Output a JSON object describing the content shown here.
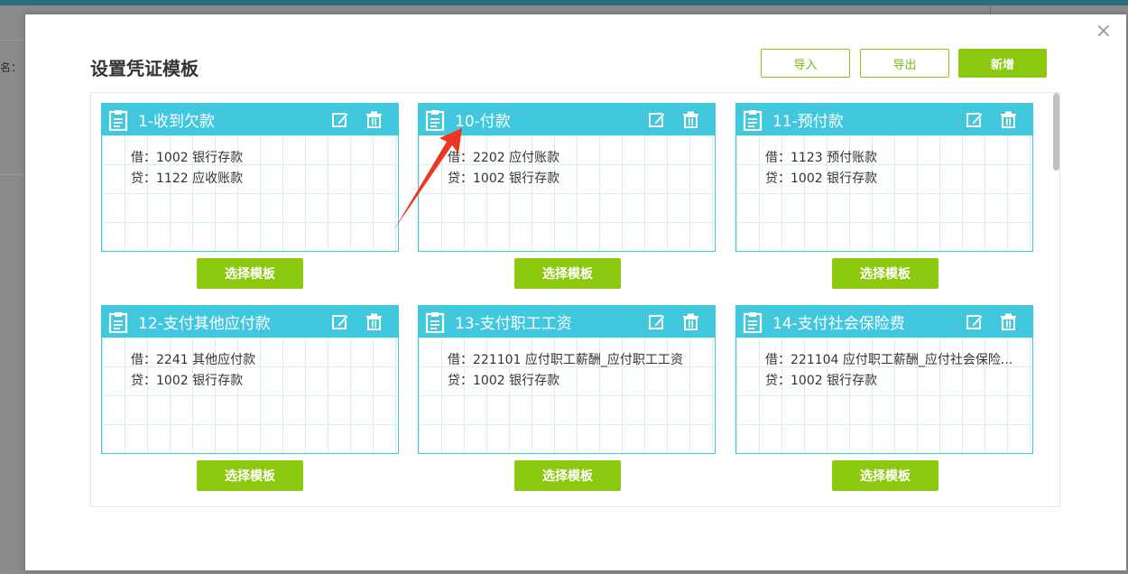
{
  "background": {
    "label": "名："
  },
  "modal": {
    "title": "设置凭证模板",
    "close_icon": "×",
    "import_label": "导入",
    "export_label": "导出",
    "add_label": "新增"
  },
  "cards": [
    {
      "title": "1-收到欠款",
      "debit": "借：1002 银行存款",
      "credit": "贷：1122 应收账款",
      "select_label": "选择模板"
    },
    {
      "title": "10-付款",
      "debit": "借：2202 应付账款",
      "credit": "贷：1002 银行存款",
      "select_label": "选择模板"
    },
    {
      "title": "11-预付款",
      "debit": "借：1123 预付账款",
      "credit": "贷：1002 银行存款",
      "select_label": "选择模板"
    },
    {
      "title": "12-支付其他应付款",
      "debit": "借：2241 其他应付款",
      "credit": "贷：1002 银行存款",
      "select_label": "选择模板"
    },
    {
      "title": "13-支付职工工资",
      "debit": "借：221101 应付职工薪酬_应付职工工资",
      "credit": "贷：1002 银行存款",
      "select_label": "选择模板"
    },
    {
      "title": "14-支付社会保险费",
      "debit": "借：221104 应付职工薪酬_应付社会保险...",
      "credit": "贷：1002 银行存款",
      "select_label": "选择模板"
    }
  ],
  "colors": {
    "header": "#41c8de",
    "button": "#8cc80f",
    "arrow": "#ee3524"
  },
  "icons": {
    "card_icon": "clipboard-icon",
    "edit": "edit-icon",
    "delete": "trash-icon"
  }
}
